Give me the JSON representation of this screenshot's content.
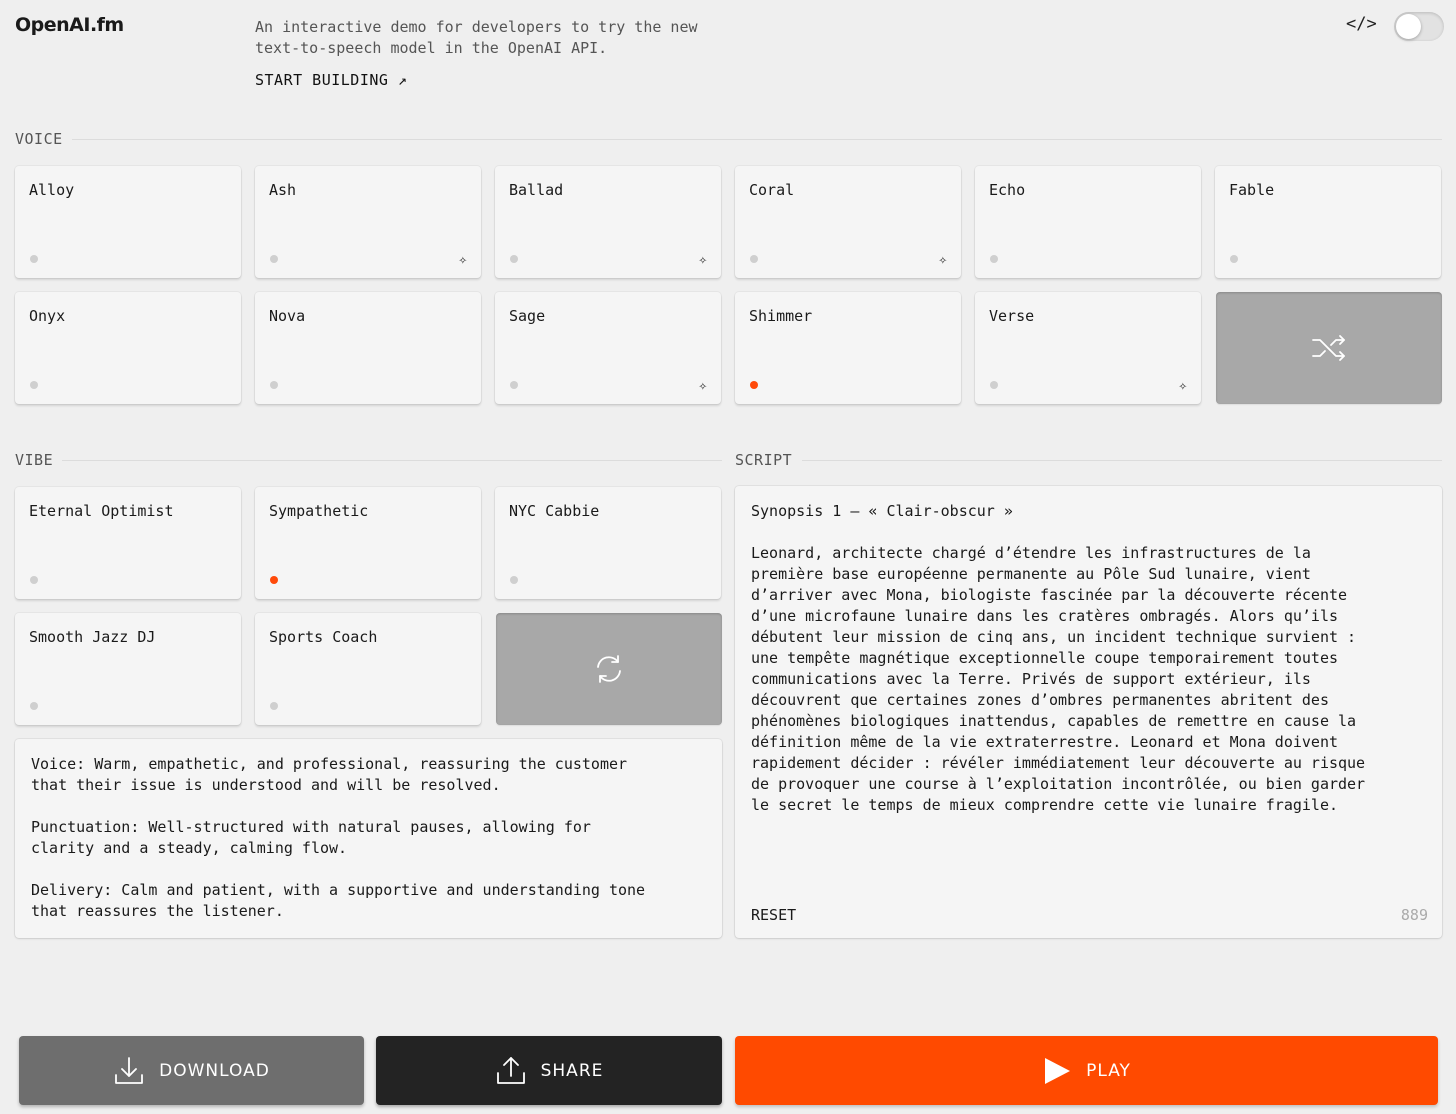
{
  "header": {
    "logo": "OpenAI.fm",
    "tagline": "An interactive demo for developers to try the new text-to-speech model in the OpenAI API.",
    "start_building": "START BUILDING ↗",
    "code_icon": "</>",
    "toggle_state": "off"
  },
  "voice": {
    "section_label": "VOICE",
    "items": [
      {
        "label": "Alloy",
        "selected": false,
        "sparkle": false
      },
      {
        "label": "Ash",
        "selected": false,
        "sparkle": true
      },
      {
        "label": "Ballad",
        "selected": false,
        "sparkle": true
      },
      {
        "label": "Coral",
        "selected": false,
        "sparkle": true
      },
      {
        "label": "Echo",
        "selected": false,
        "sparkle": false
      },
      {
        "label": "Fable",
        "selected": false,
        "sparkle": false
      },
      {
        "label": "Onyx",
        "selected": false,
        "sparkle": false
      },
      {
        "label": "Nova",
        "selected": false,
        "sparkle": false
      },
      {
        "label": "Sage",
        "selected": false,
        "sparkle": true
      },
      {
        "label": "Shimmer",
        "selected": true,
        "sparkle": false
      },
      {
        "label": "Verse",
        "selected": false,
        "sparkle": true
      }
    ],
    "shuffle_icon": "shuffle-icon"
  },
  "vibe": {
    "section_label": "VIBE",
    "items": [
      {
        "label": "Eternal Optimist",
        "selected": false
      },
      {
        "label": "Sympathetic",
        "selected": true
      },
      {
        "label": "NYC Cabbie",
        "selected": false
      },
      {
        "label": "Smooth Jazz DJ",
        "selected": false
      },
      {
        "label": "Sports Coach",
        "selected": false
      }
    ],
    "refresh_icon": "refresh-icon",
    "description": "Voice: Warm, empathetic, and professional, reassuring the customer\nthat their issue is understood and will be resolved.\n\nPunctuation: Well-structured with natural pauses, allowing for\nclarity and a steady, calming flow.\n\nDelivery: Calm and patient, with a supportive and understanding tone\nthat reassures the listener."
  },
  "script": {
    "section_label": "SCRIPT",
    "text": "Synopsis 1 – « Clair-obscur »\n\nLeonard, architecte chargé d’étendre les infrastructures de la\npremière base européenne permanente au Pôle Sud lunaire, vient\nd’arriver avec Mona, biologiste fascinée par la découverte récente\nd’une microfaune lunaire dans les cratères ombragés. Alors qu’ils\ndébutent leur mission de cinq ans, un incident technique survient :\nune tempête magnétique exceptionnelle coupe temporairement toutes\ncommunications avec la Terre. Privés de support extérieur, ils\ndécouvrent que certaines zones d’ombres permanentes abritent des\nphénomènes biologiques inattendus, capables de remettre en cause la\ndéfinition même de la vie extraterrestre. Leonard et Mona doivent\nrapidement décider : révéler immédiatement leur découverte au risque\nde provoquer une course à l’exploitation incontrôlée, ou bien garder\nle secret le temps de mieux comprendre cette vie lunaire fragile.",
    "reset_label": "RESET",
    "char_count": "889"
  },
  "actions": {
    "download_label": "DOWNLOAD",
    "share_label": "SHARE",
    "play_label": "PLAY"
  },
  "colors": {
    "accent": "#ff4a00",
    "background": "#efefef",
    "card": "#f5f5f5"
  }
}
